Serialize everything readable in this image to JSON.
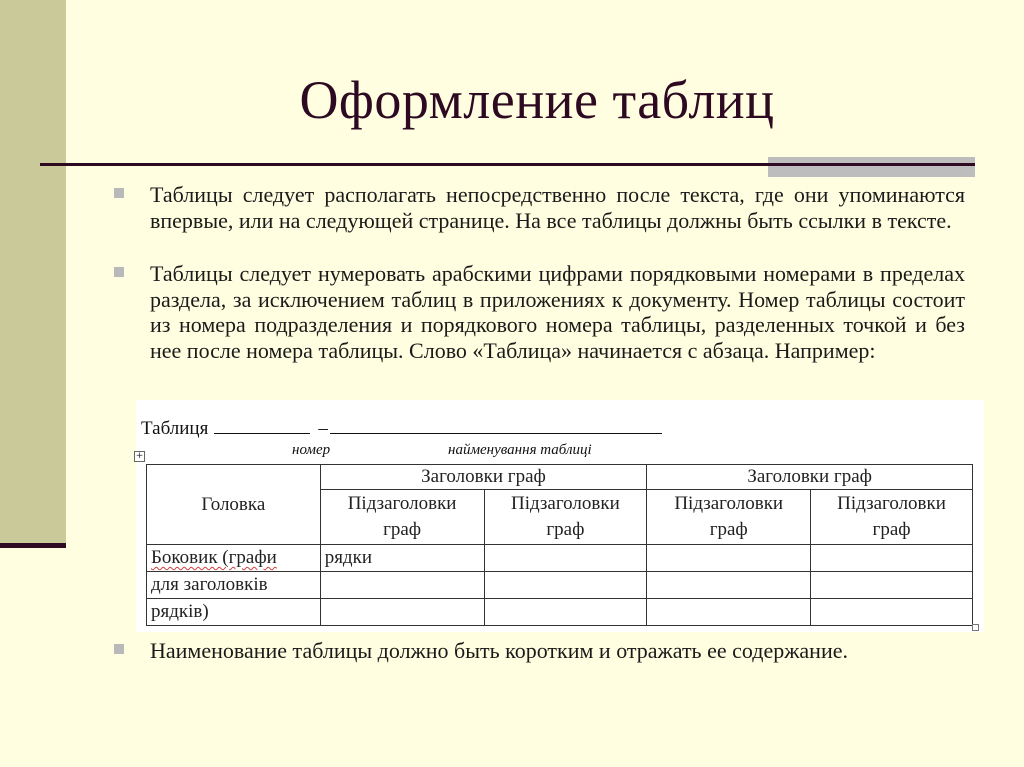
{
  "slide": {
    "title": "Оформление таблиц",
    "colors": {
      "background": "#fffee0",
      "sidebar": "#c9c99a",
      "title": "#2d0a22",
      "rule": "#2d0a22",
      "rule_accent": "#bdbdbd",
      "bullet": "#b9b9b9"
    },
    "bullets": [
      {
        "icon": "square-bullet-icon",
        "text": "Таблицы следует располагать непосредственно после текста, где они упоминаются впервые, или на следующей странице. На все таблицы должны быть ссылки в тексте."
      },
      {
        "icon": "square-bullet-icon",
        "text": "Таблицы следует нумеровать арабскими цифрами порядковыми номерами в пределах раздела, за исключением таблиц в приложениях к документу. Номер таблицы состоит из номера подразделения и порядкового номера таблицы, разделенных точкой и без нее после номера таблицы. Слово «Таблица» начинается с абзаца. Например:"
      },
      {
        "icon": "square-bullet-icon",
        "text": "Наименование таблицы должно быть коротким и отражать ее содержание."
      }
    ],
    "example": {
      "caption_label": "Таблиця",
      "dash": "–",
      "hint_number": "номер",
      "hint_name": "найменування таблиці",
      "table": {
        "head_cell": "Головка",
        "group_headers": [
          "Заголовки граф",
          "Заголовки граф"
        ],
        "sub_headers": [
          "Підзаголовки граф",
          "Підзаголовки граф",
          "Підзаголовки граф",
          "Підзаголовки граф"
        ],
        "stub_lines": [
          "Боковик (графи",
          "для заголовків",
          "рядків)"
        ],
        "first_data_cell": "рядки"
      }
    }
  }
}
